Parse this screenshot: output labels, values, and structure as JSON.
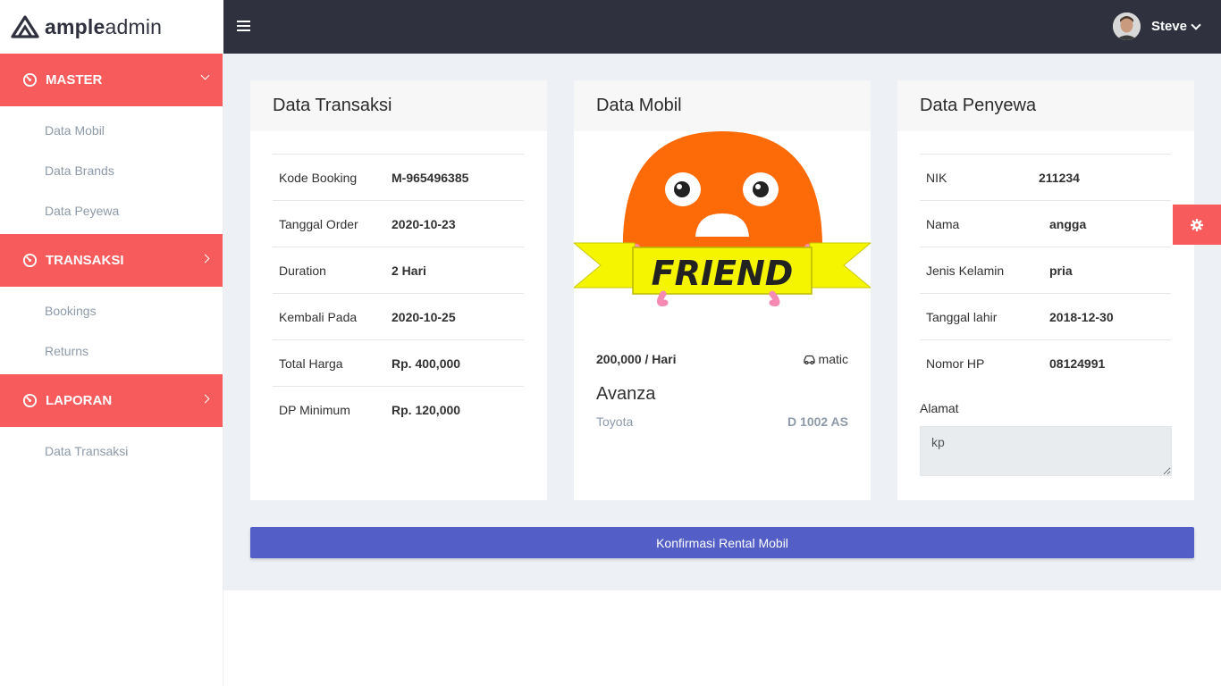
{
  "brand": {
    "bold": "ample",
    "light": "admin"
  },
  "user": {
    "name": "Steve"
  },
  "sidebar": {
    "sections": [
      {
        "label": "MASTER",
        "items": [
          "Data Mobil",
          "Data Brands",
          "Data Peyewa"
        ]
      },
      {
        "label": "TRANSAKSI",
        "items": [
          "Bookings",
          "Returns"
        ]
      },
      {
        "label": "LAPORAN",
        "items": [
          "Data Transaksi"
        ]
      }
    ]
  },
  "transaksi": {
    "title": "Data Transaksi",
    "rows": [
      {
        "k": "Kode Booking",
        "v": "M-965496385"
      },
      {
        "k": "Tanggal Order",
        "v": "2020-10-23"
      },
      {
        "k": "Duration",
        "v": "2 Hari"
      },
      {
        "k": "Kembali Pada",
        "v": "2020-10-25"
      },
      {
        "k": "Total Harga",
        "v": "Rp. 400,000"
      },
      {
        "k": "DP Minimum",
        "v": "Rp. 120,000"
      }
    ]
  },
  "mobil": {
    "title": "Data Mobil",
    "image_text": "FRIEND",
    "price": "200,000 / Hari",
    "transmission": "matic",
    "name": "Avanza",
    "brand": "Toyota",
    "plate": "D 1002 AS"
  },
  "penyewa": {
    "title": "Data Penyewa",
    "rows": [
      {
        "k": "NIK",
        "v": "211234"
      },
      {
        "k": "Nama",
        "v": "angga"
      },
      {
        "k": "Jenis Kelamin",
        "v": "pria"
      },
      {
        "k": "Tanggal lahir",
        "v": "2018-12-30"
      },
      {
        "k": "Nomor HP",
        "v": "08124991"
      }
    ],
    "alamat_label": "Alamat",
    "alamat": "kp"
  },
  "confirm_label": "Konfirmasi Rental Mobil",
  "colors": {
    "accent": "#f75b5b",
    "topbar": "#2f323e",
    "button": "#535ec7"
  }
}
